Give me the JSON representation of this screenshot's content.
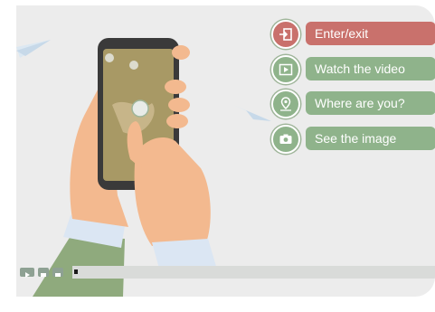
{
  "menu": {
    "items": [
      {
        "label": "Enter/exit",
        "icon": "enter-exit-icon",
        "color": "#c9716c"
      },
      {
        "label": "Watch the video",
        "icon": "play-video-icon",
        "color": "#8fb38b"
      },
      {
        "label": "Where are you?",
        "icon": "map-pin-icon",
        "color": "#8fb38b"
      },
      {
        "label": "See the image",
        "icon": "camera-icon",
        "color": "#8fb38b"
      }
    ]
  },
  "colors": {
    "background": "#ececec",
    "accent_red": "#c9716c",
    "accent_green": "#8fb38b",
    "skin": "#f3b98f",
    "sleeve": "#8faa7d",
    "cuff": "#dbe6f3"
  },
  "player": {
    "buttons": [
      "play-button-icon",
      "prev-button-icon",
      "next-button-icon"
    ],
    "progress": 0.01
  }
}
